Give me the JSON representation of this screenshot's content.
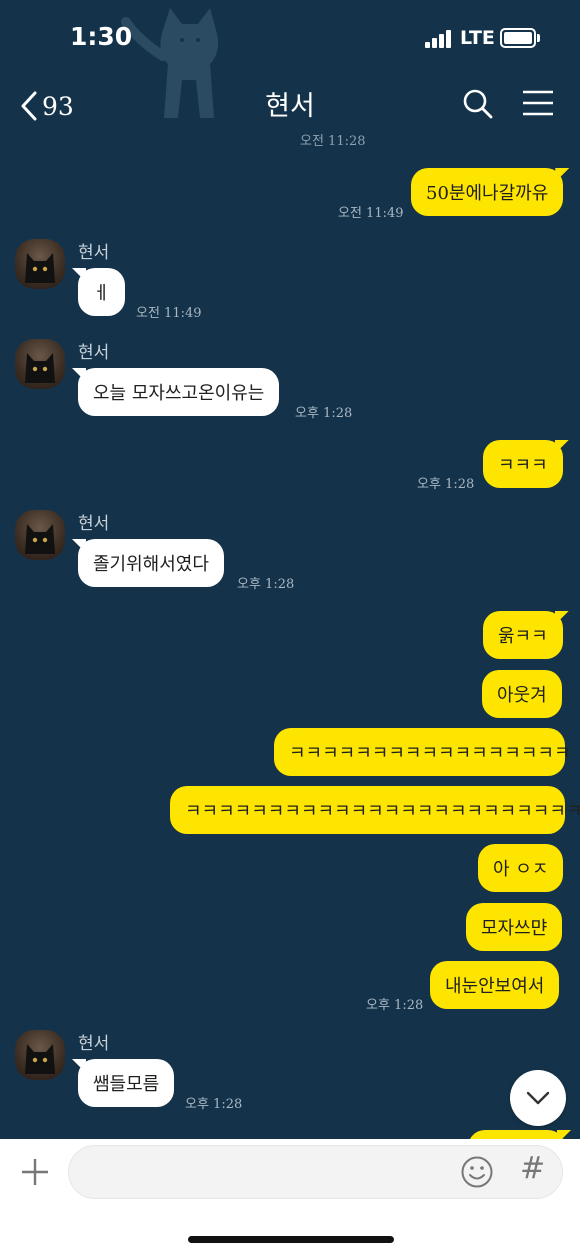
{
  "status_bar": {
    "time": "1:30",
    "network": "LTE"
  },
  "header": {
    "back_count": "93",
    "title": "현서"
  },
  "chat": {
    "top_time": "오전 11:28",
    "messages": [
      {
        "from": "me",
        "text": "50분에나갈까유",
        "time": "오전 11:49"
      },
      {
        "from": "them",
        "sender": "현서",
        "text": "ㅔ",
        "time": "오전 11:49"
      },
      {
        "from": "them",
        "sender": "현서",
        "text": "오늘 모자쓰고온이유는",
        "time": "오후 1:28"
      },
      {
        "from": "me",
        "text": "ㅋㅋㅋ",
        "time": "오후 1:28"
      },
      {
        "from": "them",
        "sender": "현서",
        "text": "졸기위해서였다",
        "time": "오후 1:28"
      },
      {
        "from": "me",
        "text": "욹ㅋㅋ"
      },
      {
        "from": "me",
        "text": "아웃겨"
      },
      {
        "from": "me",
        "text": "ㅋㅋㅋㅋㅋㅋㅋㅋㅋㅋㅋㅋㅋㅋㅋㅋㅋ"
      },
      {
        "from": "me",
        "text": "ㅋㅋㅋㅋㅋㅋㅋㅋㅋㅋㅋㅋㅋㅋㅋㅋㅋㅋㅋㅋㅋㅋㅋㅋㅋ"
      },
      {
        "from": "me",
        "text": "아 ㅇㅈ"
      },
      {
        "from": "me",
        "text": "모자쓰먄"
      },
      {
        "from": "me",
        "text": "내눈안보여서",
        "time": "오후 1:28"
      },
      {
        "from": "them",
        "sender": "현서",
        "text": "쌤들모름",
        "time": "오후 1:28"
      }
    ]
  },
  "icons": {
    "back": "chevron-left-icon",
    "search": "search-icon",
    "menu": "hamburger-menu-icon",
    "scroll_down": "chevron-down-icon",
    "attach": "plus-icon",
    "emoji": "smiley-icon",
    "hashtag": "#"
  },
  "colors": {
    "background": "#14334a",
    "my_bubble": "#fee500",
    "their_bubble": "#ffffff"
  }
}
